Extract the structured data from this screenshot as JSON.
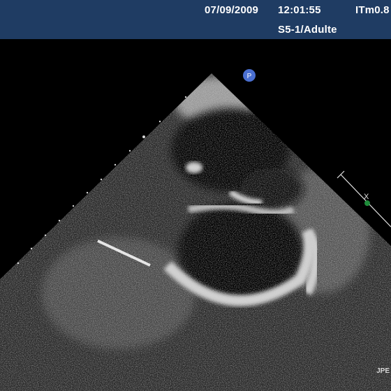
{
  "header": {
    "date": "07/09/2009",
    "time": "12:01:55",
    "itm": "ITm0.8",
    "probe": "S5-1/Adulte"
  },
  "marker_label": "P",
  "scale_mark": "X",
  "corner_text": "JPE",
  "colors": {
    "header_bg": "#1f3c63",
    "marker": "#4a6fd1",
    "scale_dot": "#1e8c3a"
  }
}
